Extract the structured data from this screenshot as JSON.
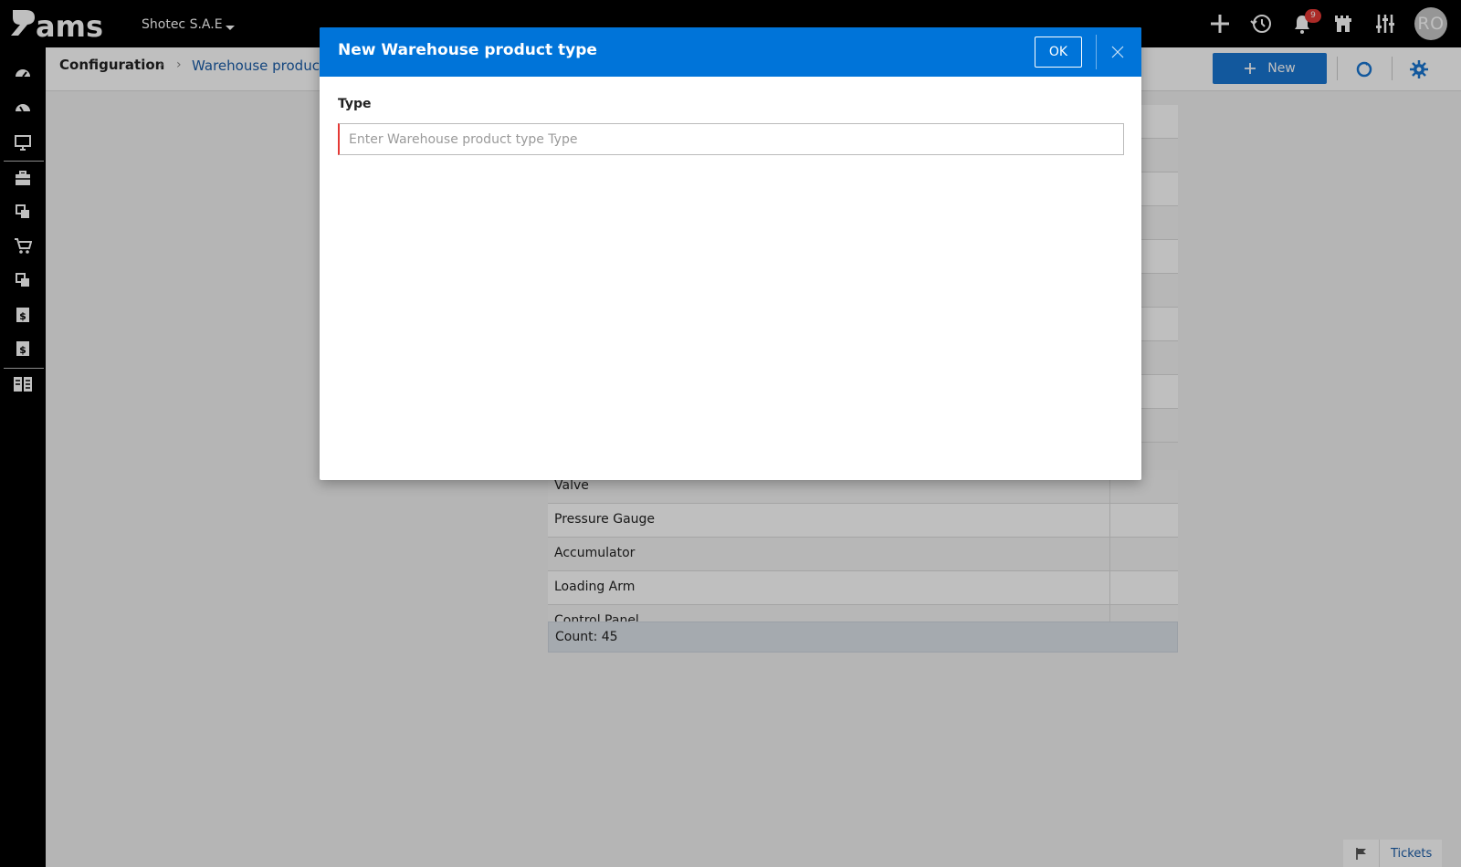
{
  "app": {
    "logo_text": "ams",
    "company": "Shotec S.A.E",
    "notification_count": "9",
    "user_initials": "RO"
  },
  "breadcrumb": {
    "root": "Configuration",
    "current": "Warehouse product types"
  },
  "toolbar": {
    "new_label": "New"
  },
  "grid": {
    "rows": [
      {
        "name": ""
      },
      {
        "name": ""
      },
      {
        "name": ""
      },
      {
        "name": ""
      },
      {
        "name": ""
      },
      {
        "name": ""
      },
      {
        "name": ""
      },
      {
        "name": ""
      },
      {
        "name": ""
      },
      {
        "name": ""
      },
      {
        "name": "Valve"
      },
      {
        "name": "Pressure Gauge"
      },
      {
        "name": "Accumulator"
      },
      {
        "name": "Loading Arm"
      },
      {
        "name": "Control Panel"
      }
    ],
    "count_label": "Count: 45"
  },
  "tickets": {
    "label": "Tickets"
  },
  "modal": {
    "title": "New Warehouse product type",
    "ok_label": "OK",
    "field_label": "Type",
    "field_placeholder": "Enter Warehouse product type Type",
    "field_value": ""
  },
  "colors": {
    "accent": "#0074d9",
    "primary_button": "#1976d2",
    "error_border": "#e53935",
    "topbar": "#000000"
  },
  "icons": {
    "topbar": [
      "plus-icon",
      "history-icon",
      "bell-icon",
      "castle-icon",
      "sliders-icon"
    ],
    "sidebar": [
      "dashboard-icon",
      "dashboard-icon",
      "monitor-icon",
      "briefcase-icon",
      "assets-icon",
      "cart-icon",
      "assets-icon",
      "invoice-icon",
      "invoice-icon",
      "reports-icon"
    ]
  }
}
